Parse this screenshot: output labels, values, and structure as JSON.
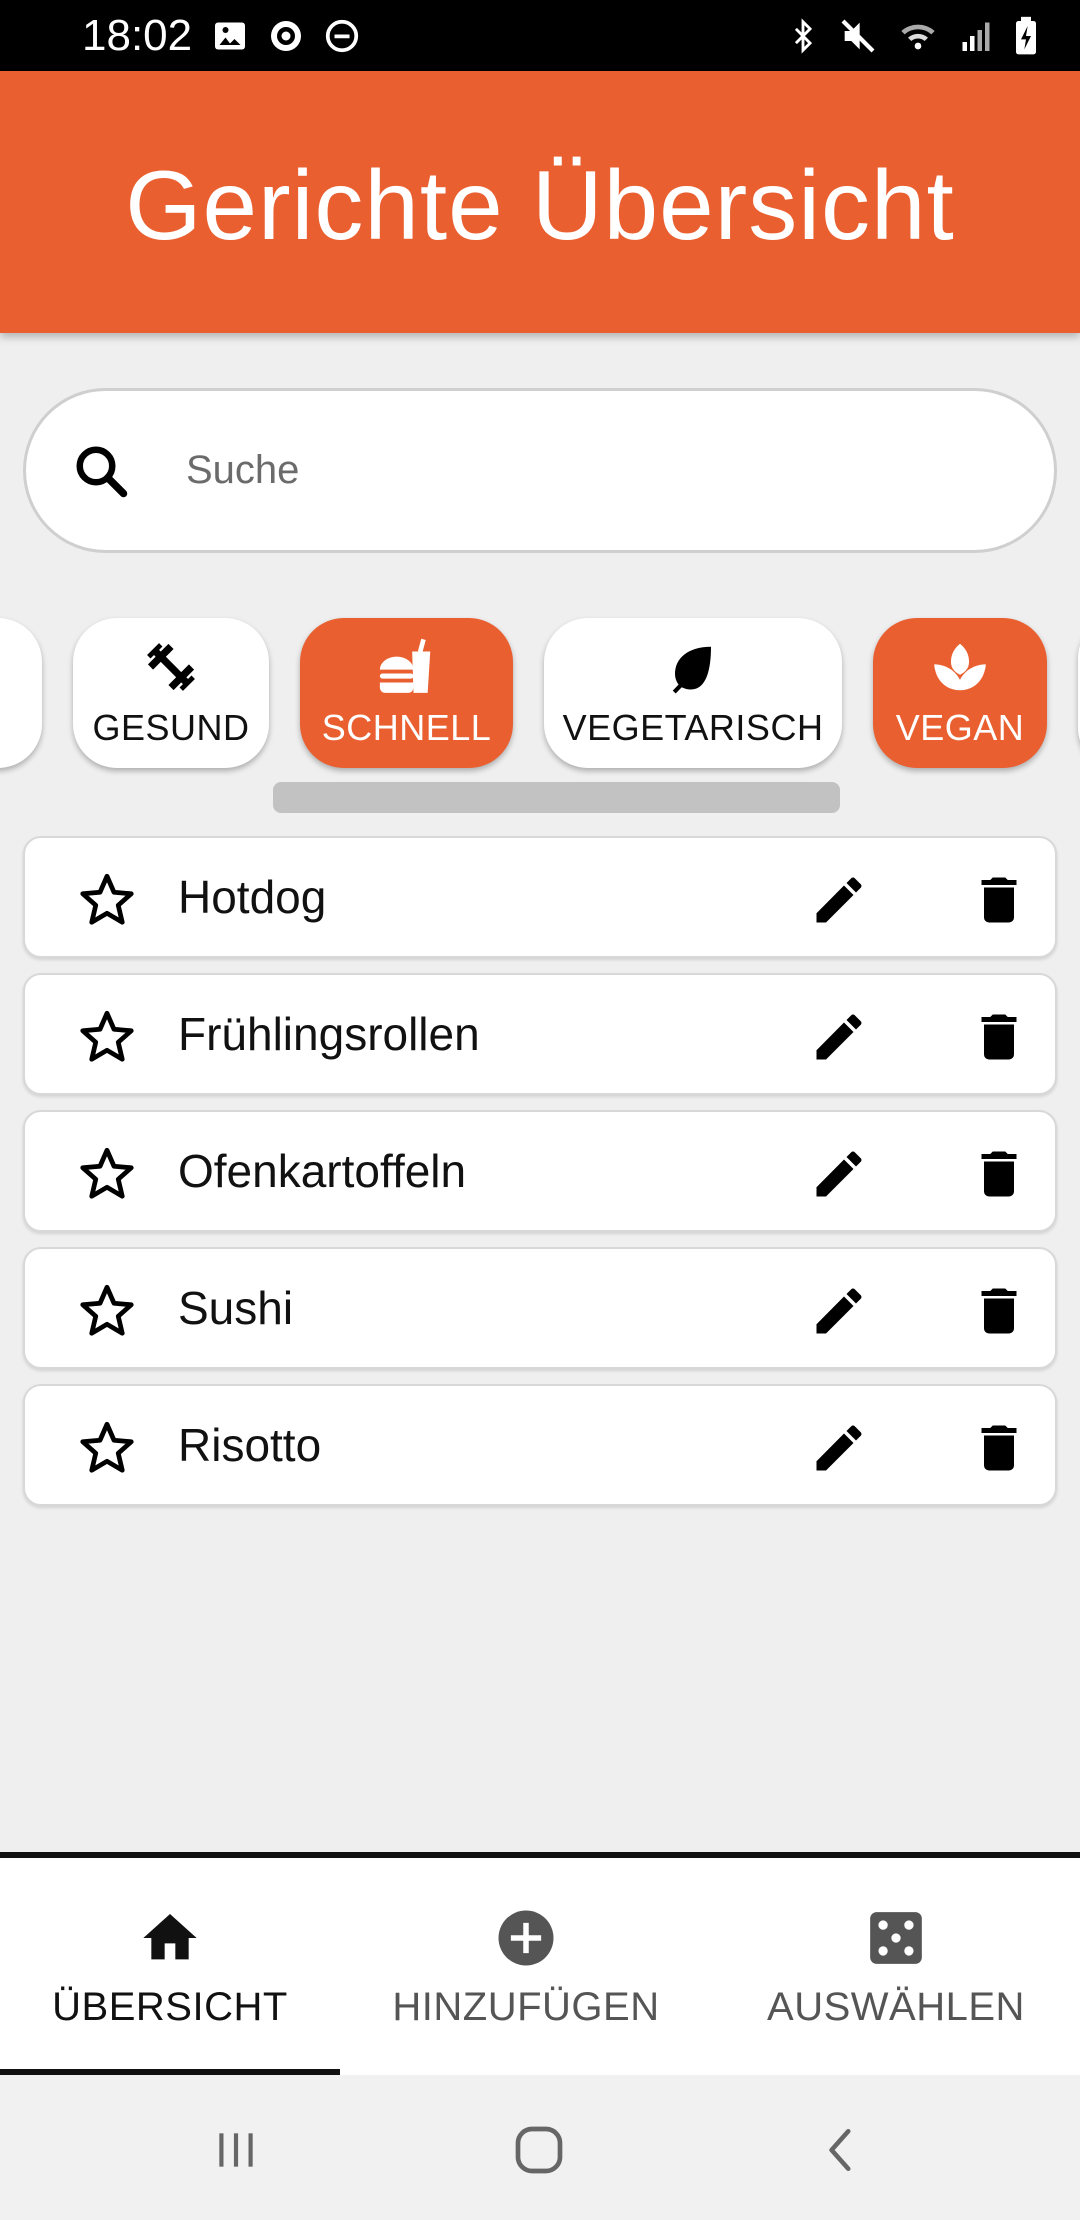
{
  "status_bar": {
    "time": "18:02",
    "left_icons": [
      "image-icon",
      "media-icon",
      "dnd-icon"
    ],
    "right_icons": [
      "bluetooth-icon",
      "mute-icon",
      "wifi-icon",
      "signal-icon",
      "battery-icon"
    ]
  },
  "app_bar": {
    "title": "Gerichte Übersicht",
    "color": "#ea5f30"
  },
  "search": {
    "placeholder": "Suche"
  },
  "filters": [
    {
      "label": "GESUND",
      "icon": "dumbbell-icon",
      "selected": false
    },
    {
      "label": "SCHNELL",
      "icon": "fastfood-icon",
      "selected": true
    },
    {
      "label": "VEGETARISCH",
      "icon": "leaf-icon",
      "selected": false
    },
    {
      "label": "VEGAN",
      "icon": "plant-icon",
      "selected": true
    }
  ],
  "dishes": [
    {
      "name": "Hotdog"
    },
    {
      "name": "Frühlingsrollen"
    },
    {
      "name": "Ofenkartoffeln"
    },
    {
      "name": "Sushi"
    },
    {
      "name": "Risotto"
    }
  ],
  "bottom_nav": [
    {
      "label": "ÜBERSICHT",
      "icon": "home-icon",
      "active": true
    },
    {
      "label": "HINZUFÜGEN",
      "icon": "add-circle-icon",
      "active": false
    },
    {
      "label": "AUSWÄHLEN",
      "icon": "dice-icon",
      "active": false
    }
  ]
}
